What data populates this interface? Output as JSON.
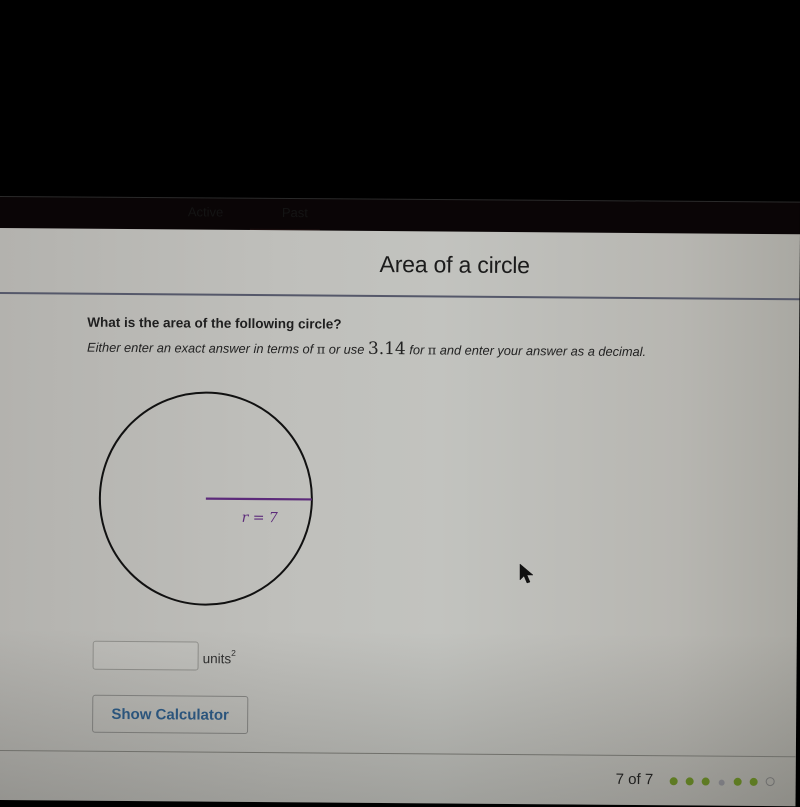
{
  "navbar": {
    "tabs": [
      {
        "label": "Active"
      },
      {
        "label": "Past"
      }
    ]
  },
  "header": {
    "title": "Area of a circle"
  },
  "question": {
    "prompt": "What is the area of the following circle?",
    "instructions_part1": "Either enter an exact answer in terms of ",
    "pi_symbol": "π",
    "instructions_part2": " or use ",
    "pi_approx": "3.14",
    "instructions_part3": " for ",
    "instructions_part4": " and enter your answer as a decimal."
  },
  "figure": {
    "shape": "circle",
    "radius_label": "r = 7",
    "radius_value": 7,
    "radius_color": "#5c2a7a"
  },
  "answer": {
    "value": "",
    "placeholder": "",
    "units_label": "units",
    "units_exponent": "2"
  },
  "buttons": {
    "show_calculator": "Show Calculator"
  },
  "progress": {
    "text": "7 of 7",
    "current": 7,
    "total": 7,
    "dots": [
      "done",
      "done",
      "done",
      "skipped",
      "done",
      "done",
      "current"
    ],
    "colors": {
      "done": "#6b8e23",
      "skipped": "#8e8e95"
    }
  }
}
